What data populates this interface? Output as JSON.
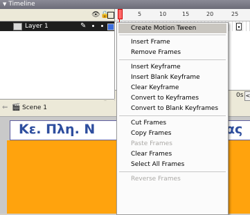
{
  "timeline": {
    "header_title": "Timeline",
    "layer_name": "Layer 1",
    "ruler_numbers": [
      "5",
      "10",
      "15",
      "20",
      "25"
    ],
    "fps_fragment": "0s",
    "scroll_left": "<"
  },
  "edit_bar": {
    "scene_label": "Scene 1"
  },
  "stage": {
    "title_left": "Κε. Πλη. Ν",
    "title_right": "ας",
    "canvas_color": "#ffa30d",
    "title_color": "#2e4e9e"
  },
  "context_menu": {
    "items": [
      {
        "label": "Create Motion Tween",
        "enabled": true,
        "highlighted": true
      },
      {
        "label": "Insert Frame",
        "enabled": true
      },
      {
        "label": "Remove Frames",
        "enabled": true
      },
      {
        "label": "Insert Keyframe",
        "enabled": true
      },
      {
        "label": "Insert Blank Keyframe",
        "enabled": true
      },
      {
        "label": "Clear Keyframe",
        "enabled": true
      },
      {
        "label": "Convert to Keyframes",
        "enabled": true
      },
      {
        "label": "Convert to Blank Keyframes",
        "enabled": true
      },
      {
        "label": "Cut Frames",
        "enabled": true
      },
      {
        "label": "Copy Frames",
        "enabled": true
      },
      {
        "label": "Paste Frames",
        "enabled": false
      },
      {
        "label": "Clear Frames",
        "enabled": true
      },
      {
        "label": "Select All Frames",
        "enabled": true
      },
      {
        "label": "Reverse Frames",
        "enabled": false
      }
    ]
  },
  "icons": {
    "eye": "eye-icon",
    "lock": "lock-icon",
    "outline": "outline-icon",
    "pencil": "pencil-icon",
    "trash": "trash-icon",
    "folder": "folder-icon",
    "scene": "scene-icon"
  }
}
